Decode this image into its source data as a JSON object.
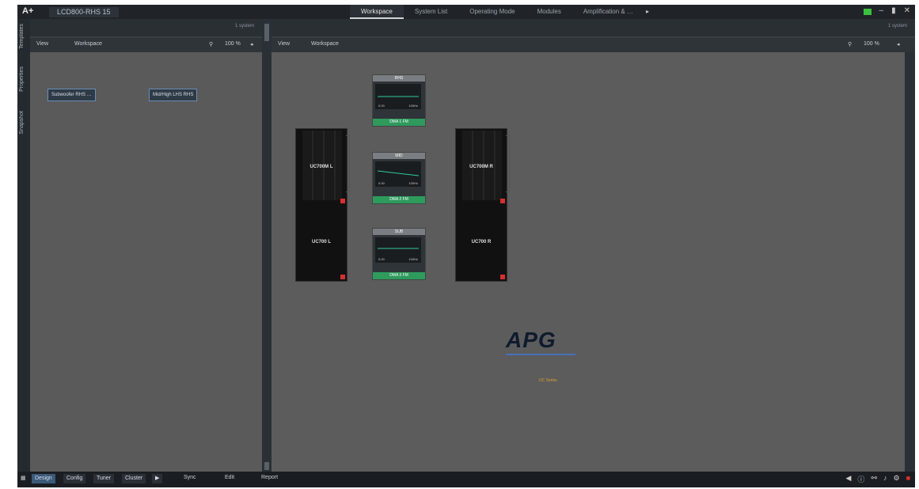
{
  "app": {
    "logo": "A+",
    "doc_title": "LCD800-RHS 15"
  },
  "tabs": [
    {
      "label": "Workspace",
      "active": true
    },
    {
      "label": "System List",
      "active": false
    },
    {
      "label": "Operating Mode",
      "active": false
    },
    {
      "label": "Modules",
      "active": false
    },
    {
      "label": "Amplification & …",
      "active": false
    }
  ],
  "tab_more": "▸",
  "window_controls": {
    "minimize": "–",
    "restore": "▮",
    "close": "✕"
  },
  "left_strip_labels": [
    "Templates",
    "Properties",
    "Snapshot"
  ],
  "left_panel": {
    "info": "1 system",
    "toolbar": {
      "view": "View",
      "mode": "Workspace",
      "zoom": "100 %"
    },
    "groups": [
      "Subwoofer RHS …",
      "Mid/High LHS RHS"
    ]
  },
  "right_panel": {
    "info": "1 system",
    "toolbar": {
      "view": "View",
      "mode": "Workspace",
      "zoom": "100 %"
    }
  },
  "speakers": [
    {
      "top_label": "UC700M L",
      "bottom_label": "UC700 L"
    },
    {
      "top_label": "UC700M R",
      "bottom_label": "UC700 R"
    }
  ],
  "processors": [
    {
      "head": "RHS",
      "lo": "0.00",
      "hi": "100Hz",
      "foot": "DMA 1 FM"
    },
    {
      "head": "MID",
      "lo": "0.00",
      "hi": "100Hz",
      "foot": "DMA 2 FM"
    },
    {
      "head": "SUB",
      "lo": "0.00",
      "hi": "100Hz",
      "foot": "DMA 3 FM"
    }
  ],
  "brand": {
    "logo": "APG",
    "sub": "UC Series"
  },
  "bottom": {
    "buttons": [
      "Design",
      "Config",
      "Tuner",
      "Cluster"
    ],
    "active": "Design",
    "actions": [
      "Sync",
      "Edit",
      "Report"
    ]
  }
}
